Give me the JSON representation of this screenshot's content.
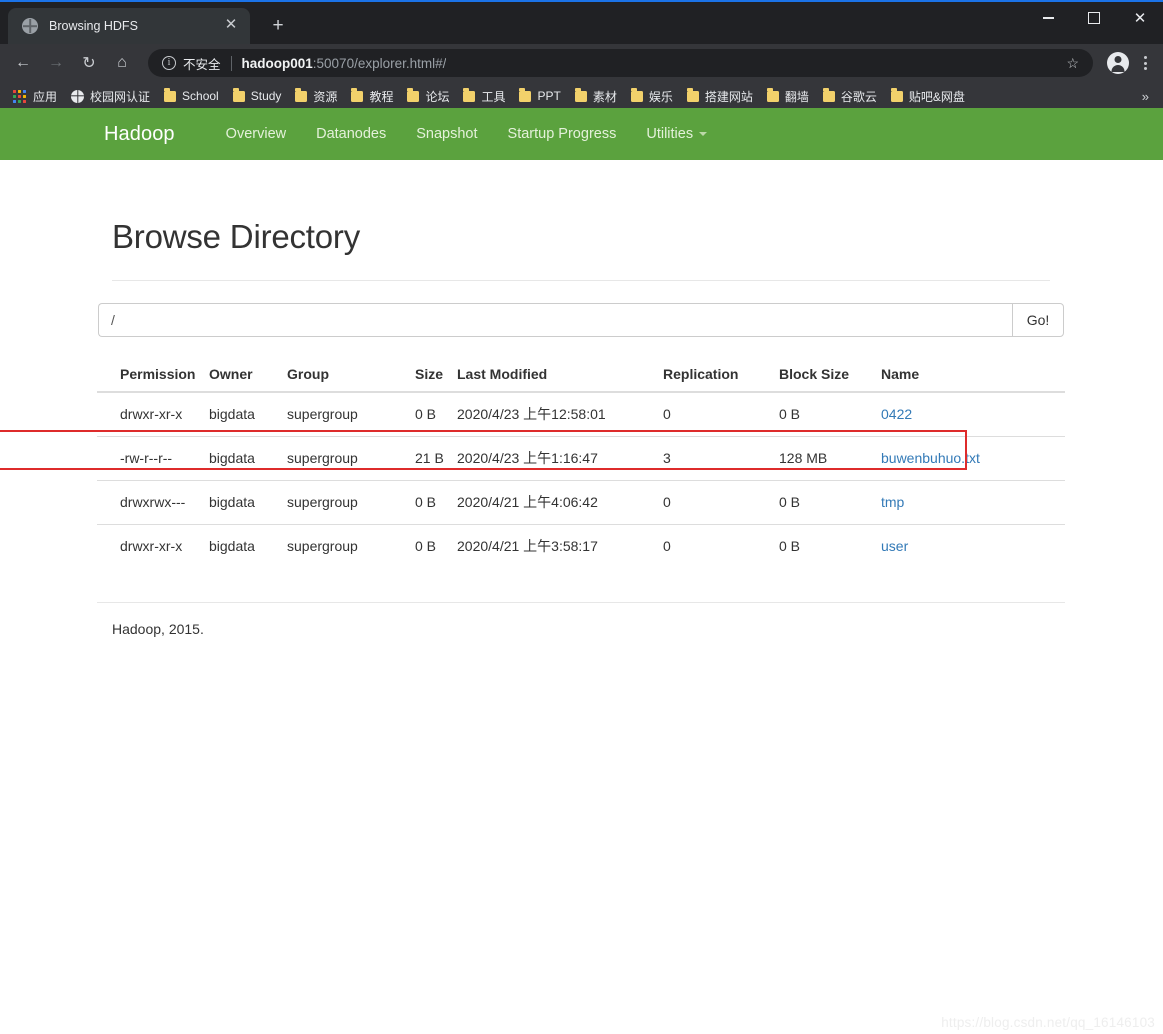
{
  "browser": {
    "tab": {
      "title": "Browsing HDFS",
      "favicon": "globe-icon",
      "close": "✕"
    },
    "new_tab": "+",
    "window_controls": {
      "minimize": "minimize-icon",
      "maximize": "maximize-icon",
      "close": "✕"
    },
    "toolbar": {
      "back": "←",
      "forward": "→",
      "reload": "↻",
      "home": "⌂",
      "security_label": "不安全",
      "url_host": "hadoop001",
      "url_rest": ":50070/explorer.html#/",
      "bookmark_star": "☆",
      "profile": "profile-avatar",
      "menu": "kebab-menu-icon"
    },
    "bookmarks": {
      "apps_label": "应用",
      "items": [
        {
          "label": "校园网认证",
          "icon": "globe-icon"
        },
        {
          "label": "School",
          "icon": "folder-icon"
        },
        {
          "label": "Study",
          "icon": "folder-icon"
        },
        {
          "label": "资源",
          "icon": "folder-icon"
        },
        {
          "label": "教程",
          "icon": "folder-icon"
        },
        {
          "label": "论坛",
          "icon": "folder-icon"
        },
        {
          "label": "工具",
          "icon": "folder-icon"
        },
        {
          "label": "PPT",
          "icon": "folder-icon"
        },
        {
          "label": "素材",
          "icon": "folder-icon"
        },
        {
          "label": "娱乐",
          "icon": "folder-icon"
        },
        {
          "label": "搭建网站",
          "icon": "folder-icon"
        },
        {
          "label": "翻墙",
          "icon": "folder-icon"
        },
        {
          "label": "谷歌云",
          "icon": "folder-icon"
        },
        {
          "label": "贴吧&网盘",
          "icon": "folder-icon"
        }
      ],
      "overflow": "»"
    }
  },
  "navbar": {
    "brand": "Hadoop",
    "items": [
      {
        "label": "Overview"
      },
      {
        "label": "Datanodes"
      },
      {
        "label": "Snapshot"
      },
      {
        "label": "Startup Progress"
      },
      {
        "label": "Utilities",
        "has_caret": true
      }
    ],
    "color": "#5ba23e"
  },
  "main": {
    "title": "Browse Directory",
    "path_value": "/",
    "go_label": "Go!",
    "table": {
      "headers": [
        "Permission",
        "Owner",
        "Group",
        "Size",
        "Last Modified",
        "Replication",
        "Block Size",
        "Name"
      ],
      "rows": [
        {
          "permission": "drwxr-xr-x",
          "owner": "bigdata",
          "group": "supergroup",
          "size": "0 B",
          "last_modified": "2020/4/23 上午12:58:01",
          "replication": "0",
          "block_size": "0 B",
          "name": "0422",
          "highlighted": false
        },
        {
          "permission": "-rw-r--r--",
          "owner": "bigdata",
          "group": "supergroup",
          "size": "21 B",
          "last_modified": "2020/4/23 上午1:16:47",
          "replication": "3",
          "block_size": "128 MB",
          "name": "buwenbuhuo.txt",
          "highlighted": true
        },
        {
          "permission": "drwxrwx---",
          "owner": "bigdata",
          "group": "supergroup",
          "size": "0 B",
          "last_modified": "2020/4/21 上午4:06:42",
          "replication": "0",
          "block_size": "0 B",
          "name": "tmp",
          "highlighted": false
        },
        {
          "permission": "drwxr-xr-x",
          "owner": "bigdata",
          "group": "supergroup",
          "size": "0 B",
          "last_modified": "2020/4/21 上午3:58:17",
          "replication": "0",
          "block_size": "0 B",
          "name": "user",
          "highlighted": false
        }
      ]
    },
    "footer": "Hadoop, 2015.",
    "link_color": "#337ab7",
    "highlight_color": "#de2b2b"
  },
  "watermark": "https://blog.csdn.net/qq_16146103"
}
